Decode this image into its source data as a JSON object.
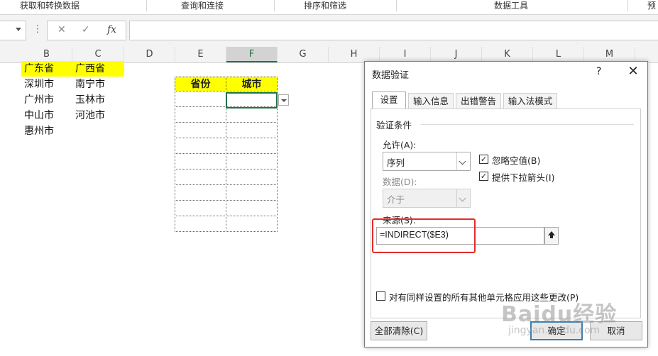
{
  "ribbon": {
    "groups": [
      "获取和转换数据",
      "查询和连接",
      "排序和筛选",
      "数据工具",
      "预"
    ]
  },
  "formula_bar": {
    "cancel_icon": "✕",
    "enter_icon": "✓",
    "fx_label": "fx",
    "value": ""
  },
  "columns": [
    "B",
    "C",
    "D",
    "E",
    "F",
    "G",
    "H",
    "I",
    "J",
    "K",
    "L",
    "M"
  ],
  "selected_column": "F",
  "sheet": {
    "b_col": [
      "广东省",
      "深圳市",
      "广州市",
      "中山市",
      "惠州市"
    ],
    "c_col": [
      "广西省",
      "南宁市",
      "玉林市",
      "河池市"
    ],
    "table_headers": {
      "province": "省份",
      "city": "城市"
    }
  },
  "dialog": {
    "title": "数据验证",
    "help": "?",
    "close": "✕",
    "tabs": [
      "设置",
      "输入信息",
      "出错警告",
      "输入法模式"
    ],
    "active_tab": "设置",
    "group_label": "验证条件",
    "allow_label": "允许(A):",
    "allow_value": "序列",
    "ignore_blank_label": "忽略空值(B)",
    "ignore_blank_checked": true,
    "dropdown_label": "提供下拉箭头(I)",
    "dropdown_checked": true,
    "data_label": "数据(D):",
    "data_value": "介于",
    "source_label": "来源(S):",
    "source_value": "=INDIRECT($E3)",
    "apply_all_label": "对有同样设置的所有其他单元格应用这些更改(P)",
    "apply_all_checked": false,
    "clear_button": "全部清除(C)",
    "ok_button": "确定",
    "cancel_button": "取消"
  },
  "watermark": {
    "brand": "Baidu经验",
    "url": "jingyan.baidu.com"
  },
  "colors": {
    "highlight_yellow": "#ffff00",
    "annotation_red": "#e52b2b",
    "excel_green": "#217346"
  }
}
